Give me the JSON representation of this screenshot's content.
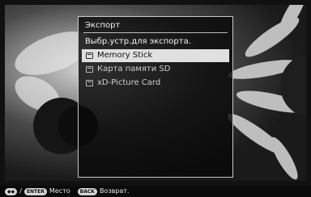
{
  "dialog": {
    "title": "Экспорт",
    "prompt": "Выбр.устр.для экспорта.",
    "items": [
      {
        "label": "Memory Stick",
        "selected": true
      },
      {
        "label": "Карта памяти SD",
        "selected": false
      },
      {
        "label": "xD-Picture Card",
        "selected": false
      }
    ]
  },
  "hint_bar": {
    "nav_key": "◆◆",
    "separator": "/",
    "enter_key": "ENTER",
    "enter_label": "Место",
    "back_key": "BACK",
    "back_label": "Возврат."
  },
  "icons": {
    "nav": "dpad-icon",
    "card": "memory-card-icon"
  }
}
